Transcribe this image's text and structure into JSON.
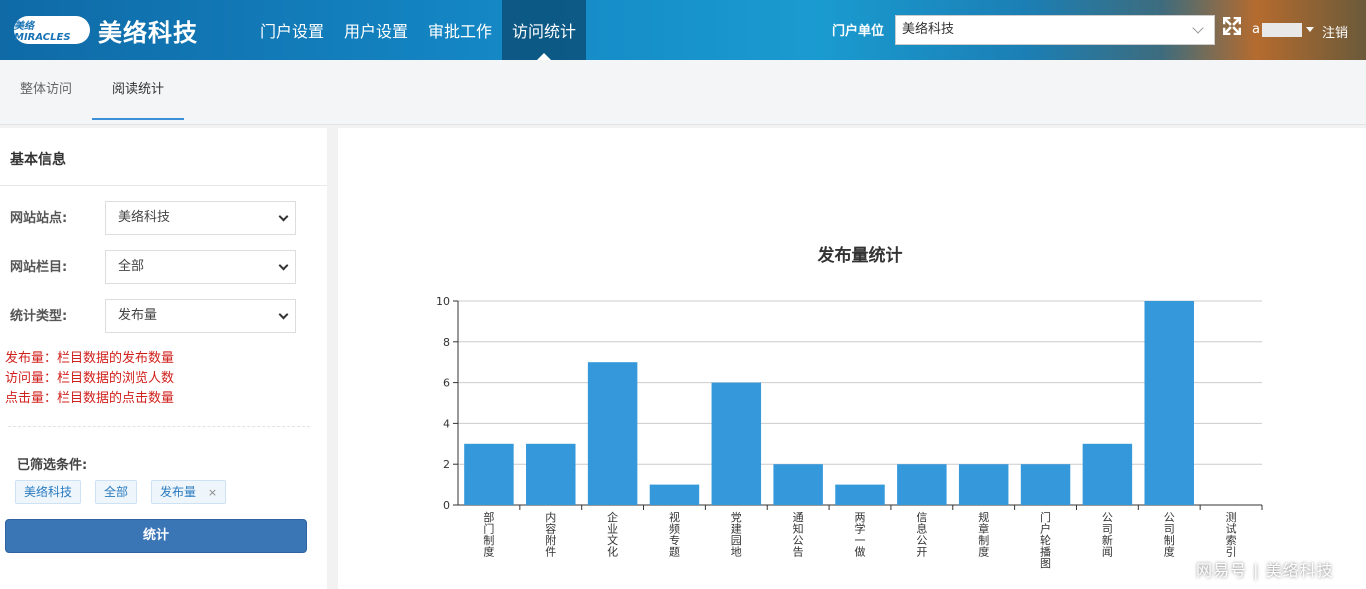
{
  "header": {
    "logo_mark": "美络MIRACLES",
    "logo_text": "美络科技",
    "nav": [
      "门户设置",
      "用户设置",
      "审批工作",
      "访问统计"
    ],
    "active_nav": 3,
    "unit_label": "门户单位",
    "unit_value": "美络科技",
    "user_initial": "a",
    "logout": "注销"
  },
  "subtabs": [
    "整体访问",
    "阅读统计"
  ],
  "active_subtab": 1,
  "left": {
    "title": "基本信息",
    "fields": [
      {
        "label": "网站站点:",
        "value": "美络科技"
      },
      {
        "label": "网站栏目:",
        "value": "全部"
      },
      {
        "label": "统计类型:",
        "value": "发布量"
      }
    ],
    "notes": [
      "发布量：栏目数据的发布数量",
      "访问量：栏目数据的浏览人数",
      "点击量：栏目数据的点击数量"
    ],
    "filter_title": "已筛选条件:",
    "chips": [
      "美络科技",
      "全部",
      "发布量"
    ],
    "chip_remove": "×",
    "submit": "统计"
  },
  "chart_data": {
    "type": "bar",
    "title": "发布量统计",
    "categories": [
      "部门制度",
      "内容附件",
      "企业文化",
      "视频专题",
      "党建园地",
      "通知公告",
      "两学一做",
      "信息公开",
      "规章制度",
      "门户轮播图",
      "公司新闻",
      "公司制度",
      "测试索引"
    ],
    "values": [
      3,
      3,
      7,
      1,
      6,
      2,
      1,
      2,
      2,
      2,
      3,
      10,
      0
    ],
    "ylim": [
      0,
      10
    ],
    "yticks": [
      0,
      2,
      4,
      6,
      8,
      10
    ],
    "color": "#3498db",
    "grid": true
  },
  "watermark": "网易号 | 美络科技"
}
